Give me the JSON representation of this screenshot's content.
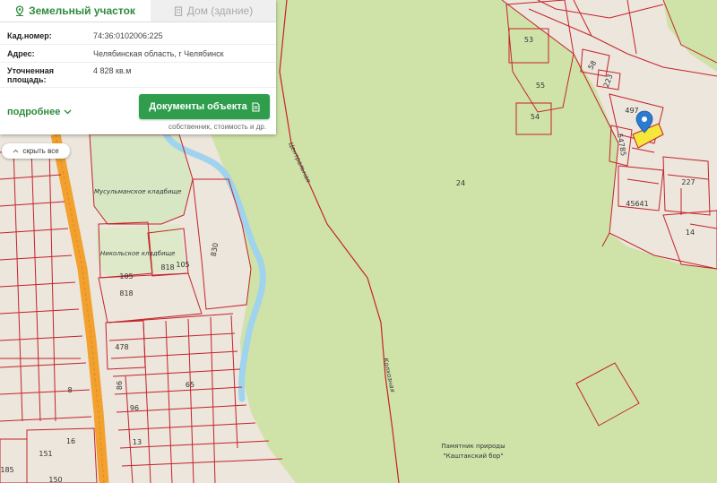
{
  "tabs": [
    {
      "label": "Земельный участок",
      "icon": "map-pin-icon",
      "active": true
    },
    {
      "label": "Дом (здание)",
      "icon": "building-icon",
      "active": false
    }
  ],
  "info": {
    "cadastral_label": "Кад.номер:",
    "cadastral_value": "74:36:0102006:225",
    "address_label": "Адрес:",
    "address_value": "Челябинская область, г Челябинск",
    "area_label_line1": "Уточненная",
    "area_label_line2": "площадь:",
    "area_value": "4 828 кв.м"
  },
  "more_label": "подробнее",
  "documents_button": "Документы объекта",
  "documents_note": "собственник, стоимость и др.",
  "hide_all_label": "скрыть все",
  "map": {
    "colors": {
      "forest": "#cfe3a8",
      "urban": "#ece6dc",
      "parcel_border": "#c4222a",
      "road": "#f2a12e",
      "river": "#9fd3ee",
      "marker": "#2b7bd1",
      "selected": "#f5e83a"
    },
    "parcel_numbers": [
      "53",
      "55",
      "54",
      "58",
      "497",
      "223",
      "54785",
      "24",
      "227",
      "45641",
      "14",
      "830",
      "818",
      "105",
      "105",
      "818",
      "478",
      "86",
      "96",
      "65",
      "13",
      "151",
      "185",
      "150",
      "8",
      "16"
    ],
    "street_labels": [
      "Центральная",
      "Колхозная"
    ],
    "place_labels": [
      "Мусульманское кладбище",
      "Никольское кладбище"
    ],
    "nature_label_line1": "Памятник природы",
    "nature_label_line2": "\"Каштакский бор\""
  }
}
